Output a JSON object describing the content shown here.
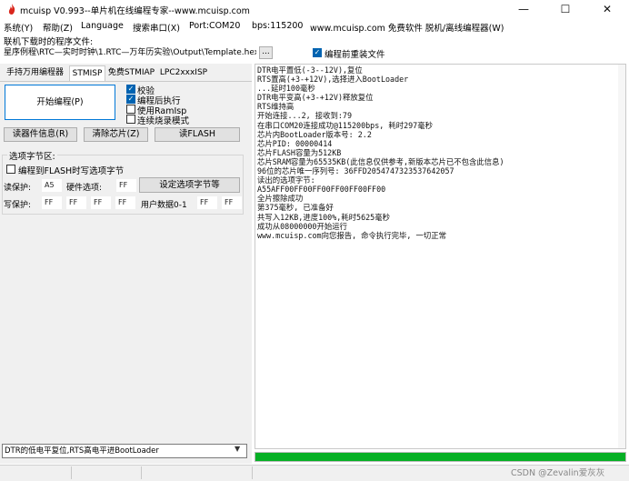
{
  "window": {
    "title": "mcuisp V0.993--单片机在线编程专家--www.mcuisp.com",
    "minimize": "—",
    "maximize": "☐",
    "close": "✕"
  },
  "menu": {
    "items": [
      "系统(Y)",
      "帮助(Z)",
      "Language",
      "搜索串口(X)",
      "Port:COM20",
      "bps:115200",
      "www.mcuisp.com 免费软件 脱机/离线编程器(W)"
    ]
  },
  "file": {
    "label": "联机下载时的程序文件:",
    "path": "星序例程\\RTC—实时时钟\\1.RTC—万年历实验\\Output\\Template.hex",
    "browse": "...",
    "reprogram_label": "编程前重装文件",
    "reprogram_checked": true
  },
  "tabs": [
    "手持万用编程器",
    "STMISP",
    "免费STMIAP",
    "LPC2xxxISP"
  ],
  "stmisp": {
    "start_button": "开始编程(P)",
    "options": [
      {
        "label": "校验",
        "checked": true
      },
      {
        "label": "编程后执行",
        "checked": true
      },
      {
        "label": "使用RamIsp",
        "checked": false
      },
      {
        "label": "连续烧录模式",
        "checked": false
      }
    ],
    "read_info_button": "读器件信息(R)",
    "erase_button": "清除芯片(Z)",
    "read_flash_button": "读FLASH",
    "option_group_title": "选项字节区:",
    "flash_opt_label": "编程到FLASH时写选项字节",
    "read_protect_label": "读保护:",
    "read_protect_value": "A5",
    "hw_option_label": "硬件选项:",
    "hw_option_value": "FF",
    "set_option_button": "设定选项字节等",
    "write_protect_label": "写保护:",
    "write_protect_values": [
      "FF",
      "FF",
      "FF",
      "FF"
    ],
    "user_data_label": "用户数据0-1",
    "user_data_values": [
      "FF",
      "FF"
    ]
  },
  "log": [
    "DTR电平置低(-3--12V),复位",
    "RTS置高(+3-+12V),选择进入BootLoader",
    "...延时100毫秒",
    "DTR电平变高(+3-+12V)释放复位",
    "RTS维持高",
    "开始连接...2, 接收到:79",
    "在串口COM20连接成功@115200bps, 耗时297毫秒",
    "芯片内BootLoader版本号: 2.2",
    "芯片PID: 00000414",
    "芯片FLASH容量为512KB",
    "芯片SRAM容量为65535KB(此信息仅供参考,新版本芯片已不包含此信息)",
    "96位的芯片唯一序列号: 36FFD2054747323537642057",
    "读出的选项字节:",
    "A55AFF00FF00FF00FF00FF00FF00",
    "全片擦除成功",
    "第375毫秒, 已准备好",
    "共写入12KB,进度100%,耗时5625毫秒",
    "成功从08000000开始运行",
    "www.mcuisp.com向您报告, 命令执行完毕, 一切正常"
  ],
  "mode_select": "DTR的低电平复位,RTS高电平进BootLoader",
  "progress": {
    "percent": 100,
    "color": "#06b025"
  },
  "watermark": "CSDN @Zevalin爱灰灰",
  "colors": {
    "accent": "#0078d7",
    "checkbox": "#0063b1",
    "icon": "#d9261c"
  }
}
